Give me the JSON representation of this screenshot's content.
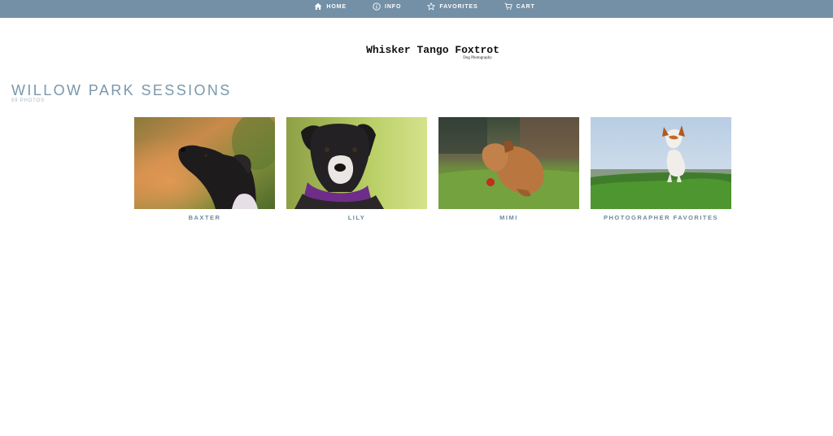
{
  "nav": {
    "items": [
      {
        "label": "HOME",
        "icon": "home-icon"
      },
      {
        "label": "INFO",
        "icon": "info-icon"
      },
      {
        "label": "FAVORITES",
        "icon": "star-icon"
      },
      {
        "label": "CART",
        "icon": "cart-icon"
      }
    ]
  },
  "logo": {
    "title": "Whisker Tango Foxtrot",
    "subtitle": "Dog Photography"
  },
  "gallery": {
    "title": "WILLOW PARK SESSIONS",
    "count": "59 PHOTOS",
    "albums": [
      {
        "label": "BAXTER"
      },
      {
        "label": "LILY"
      },
      {
        "label": "MIMI"
      },
      {
        "label": "PHOTOGRAPHER FAVORITES"
      }
    ]
  },
  "colors": {
    "topbar": "#7490a6",
    "accent": "#6b8aa1",
    "title": "#7b97ab"
  }
}
